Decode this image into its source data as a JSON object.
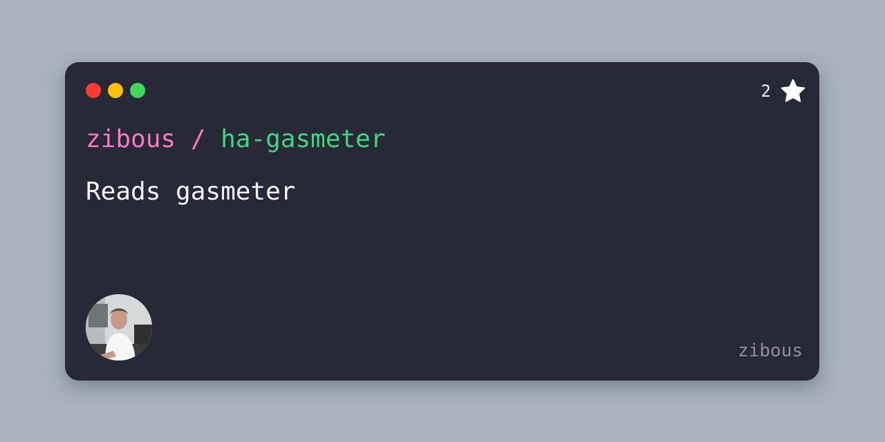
{
  "card": {
    "window_dots": [
      "red",
      "yellow",
      "green"
    ],
    "colors": {
      "dot_red": "#fe3b30",
      "dot_yellow": "#fec10a",
      "dot_green": "#3fd85a",
      "owner": "#f778c3",
      "repo": "#3ed77f",
      "background": "#282936"
    },
    "stars": {
      "count": "2",
      "icon": "star-icon"
    },
    "repo": {
      "owner": "zibous",
      "separator": "/",
      "name": "ha-gasmeter"
    },
    "description": "Reads gasmeter",
    "avatar": {
      "icon": "avatar"
    },
    "footer_user": "zibous"
  }
}
